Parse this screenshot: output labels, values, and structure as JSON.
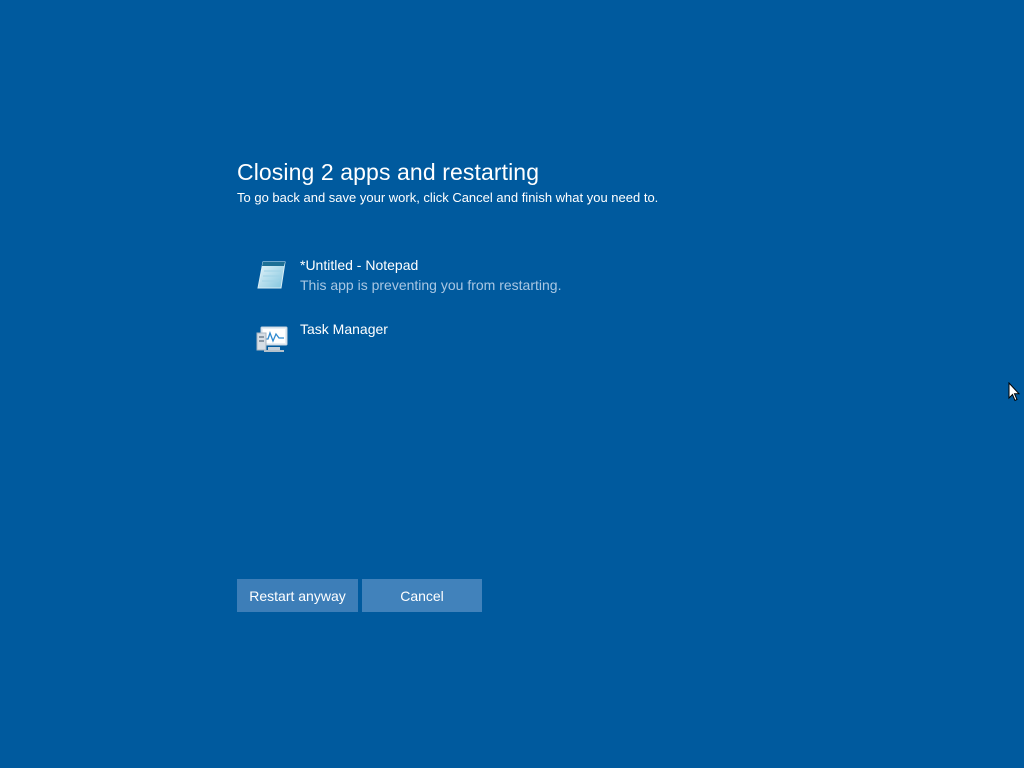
{
  "dialog": {
    "title": "Closing 2 apps and restarting",
    "subtitle": "To go back and save your work, click Cancel and finish what you need to."
  },
  "apps": [
    {
      "name": "*Untitled - Notepad",
      "status": "This app is preventing you from restarting.",
      "icon": "notepad-icon"
    },
    {
      "name": "Task Manager",
      "status": "",
      "icon": "task-manager-icon"
    }
  ],
  "buttons": {
    "restart_label": "Restart anyway",
    "cancel_label": "Cancel"
  },
  "colors": {
    "background": "#005a9e",
    "button": "#3d7eb8",
    "status_text": "#a9c7e3"
  }
}
